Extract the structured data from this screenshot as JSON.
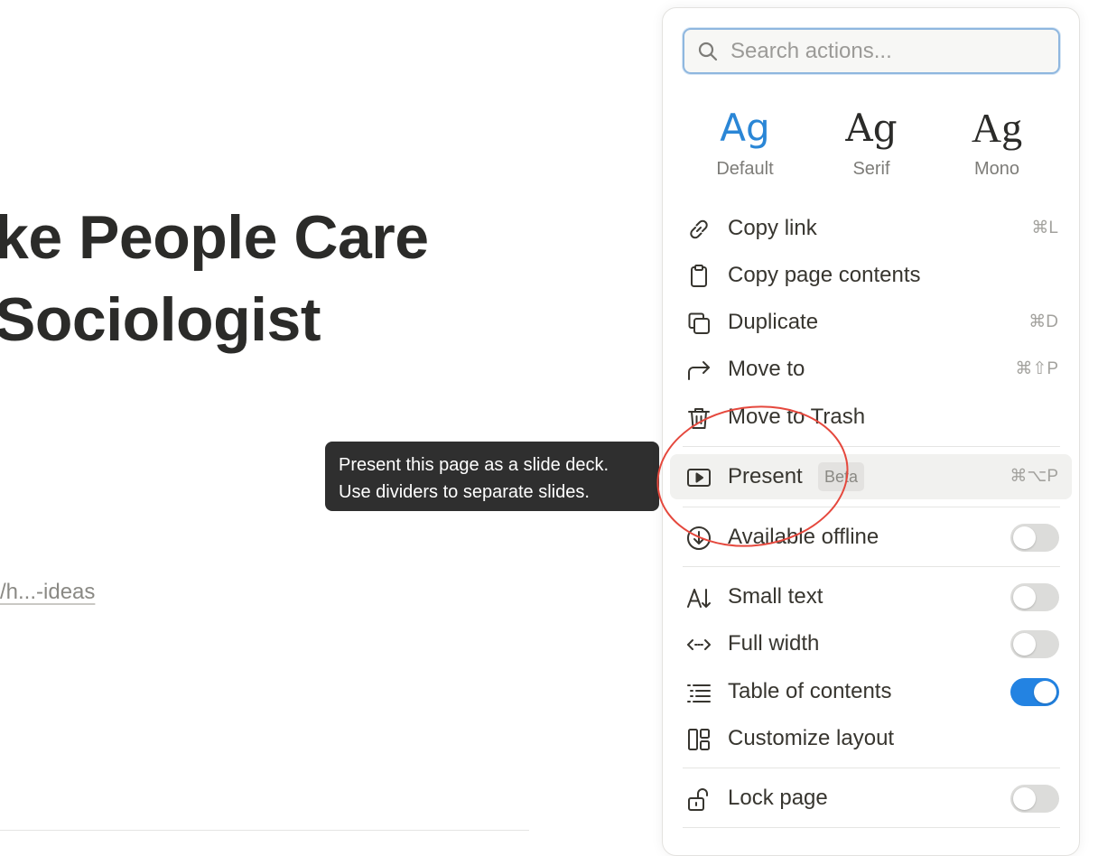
{
  "page": {
    "title_line1": "ke People Care",
    "title_line2": "Sociologist",
    "link_text": "/h...-ideas"
  },
  "tooltip": {
    "line1": "Present this page as a slide deck.",
    "line2": "Use dividers to separate slides."
  },
  "menu": {
    "search_placeholder": "Search actions...",
    "fonts": [
      {
        "sample": "Ag",
        "label": "Default",
        "selected": true
      },
      {
        "sample": "Ag",
        "label": "Serif",
        "selected": false
      },
      {
        "sample": "Ag",
        "label": "Mono",
        "selected": false
      }
    ],
    "items": {
      "copy_link": {
        "label": "Copy link",
        "shortcut": "⌘L",
        "icon": "link-icon"
      },
      "copy_contents": {
        "label": "Copy page contents",
        "shortcut": "",
        "icon": "clipboard-icon"
      },
      "duplicate": {
        "label": "Duplicate",
        "shortcut": "⌘D",
        "icon": "duplicate-icon"
      },
      "move_to": {
        "label": "Move to",
        "shortcut": "⌘⇧P",
        "icon": "move-arrow-icon"
      },
      "trash": {
        "label": "Move to Trash",
        "shortcut": "",
        "icon": "trash-icon"
      },
      "present": {
        "label": "Present",
        "badge": "Beta",
        "shortcut": "⌘⌥P",
        "icon": "present-icon"
      },
      "offline": {
        "label": "Available offline",
        "toggle": false,
        "icon": "download-circle-icon"
      },
      "small_text": {
        "label": "Small text",
        "toggle": false,
        "icon": "small-text-icon"
      },
      "full_width": {
        "label": "Full width",
        "toggle": false,
        "icon": "horizontal-arrows-icon"
      },
      "toc": {
        "label": "Table of contents",
        "toggle": true,
        "icon": "list-icon"
      },
      "customize": {
        "label": "Customize layout",
        "icon": "layout-icon"
      },
      "lock": {
        "label": "Lock page",
        "toggle": false,
        "icon": "lock-icon"
      }
    }
  },
  "colors": {
    "accent": "#2383e2",
    "annotation": "#e5483d",
    "tooltip_bg": "#2f2f2f"
  }
}
